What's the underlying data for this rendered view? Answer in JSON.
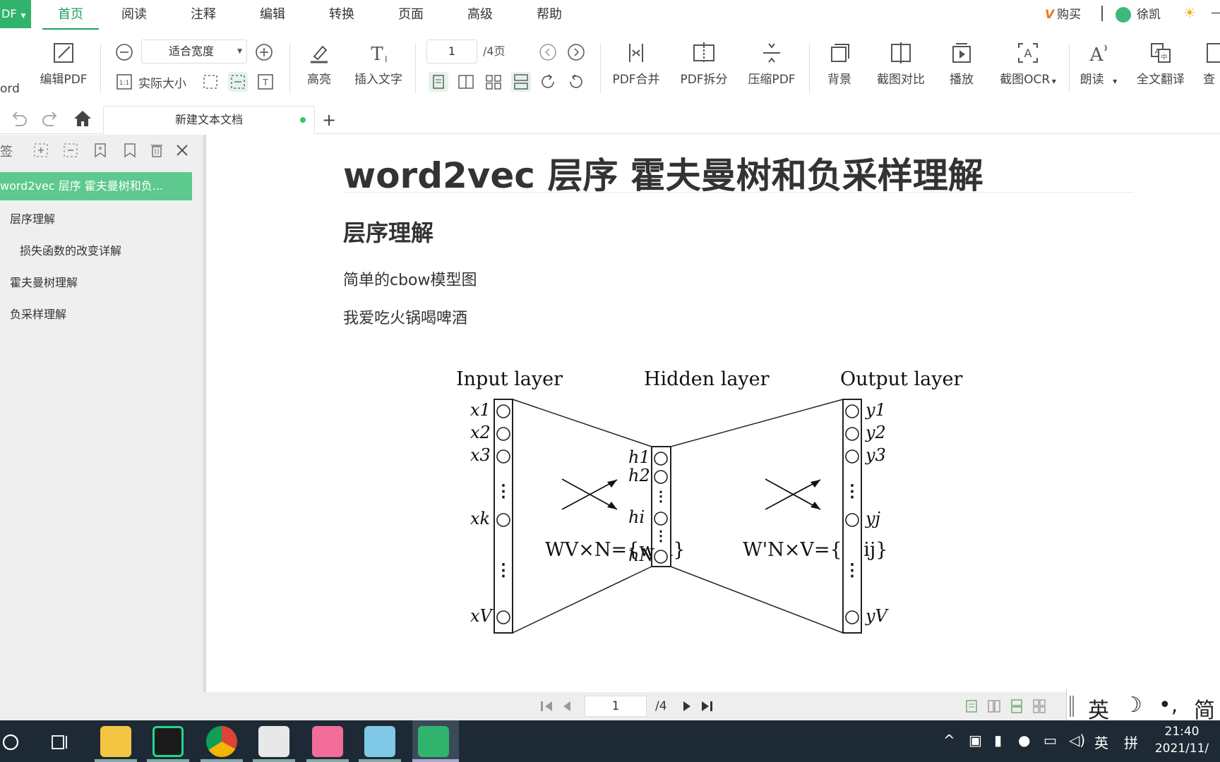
{
  "menubar": {
    "app_label": "DF",
    "items": [
      {
        "label": "首页",
        "active": true
      },
      {
        "label": "阅读"
      },
      {
        "label": "注释"
      },
      {
        "label": "编辑"
      },
      {
        "label": "转换"
      },
      {
        "label": "页面"
      },
      {
        "label": "高级"
      },
      {
        "label": "帮助"
      }
    ],
    "buy_label": "购买",
    "user_name": "徐凯"
  },
  "toolbar": {
    "to_word_label": "ord",
    "edit_pdf_label": "编辑PDF",
    "zoom_value": "适合宽度",
    "actual_size_label": "实际大小",
    "highlight_label": "高亮",
    "insert_text_label": "插入文字",
    "page_value": "1",
    "page_total": "/4页",
    "merge_label": "PDF合并",
    "split_label": "PDF拆分",
    "compress_label": "压缩PDF",
    "background_label": "背景",
    "compare_label": "截图对比",
    "play_label": "播放",
    "ocr_label": "截图OCR",
    "read_aloud_label": "朗读",
    "translate_label": "全文翻译",
    "search_label": "查"
  },
  "tabs": {
    "active_title": "新建文本文档"
  },
  "sidebar": {
    "header_label": "签",
    "bookmarks": [
      {
        "label": "word2vec 层序  霍夫曼树和负...",
        "level": 0,
        "active": true
      },
      {
        "label": "层序理解",
        "level": 1
      },
      {
        "label": "损失函数的改变详解",
        "level": 2
      },
      {
        "label": "霍夫曼树理解",
        "level": 1
      },
      {
        "label": "负采样理解",
        "level": 1
      }
    ]
  },
  "document": {
    "title": "word2vec 层序 霍夫曼树和负采样理解",
    "heading": "层序理解",
    "para1": "简单的cbow模型图",
    "para2": "我爱吃火锅喝啤酒",
    "figure": {
      "input_title": "Input layer",
      "hidden_title": "Hidden layer",
      "output_title": "Output layer",
      "x_labels": [
        "x1",
        "x2",
        "x3",
        "xk",
        "xV"
      ],
      "h_labels": [
        "h1",
        "h2",
        "hi",
        "hN"
      ],
      "y_labels": [
        "y1",
        "y2",
        "y3",
        "yj",
        "yV"
      ],
      "w_left": "WV×N={wki}",
      "w_right": "W'N×V={w'ij}"
    }
  },
  "bottombar": {
    "page_value": "1",
    "page_total": "/4"
  },
  "ime": {
    "lang": "英",
    "mode": "简"
  },
  "taskbar": {
    "tray_lang": "英",
    "tray_pinyin": "拼",
    "time": "21:40",
    "date": "2021/11/"
  }
}
